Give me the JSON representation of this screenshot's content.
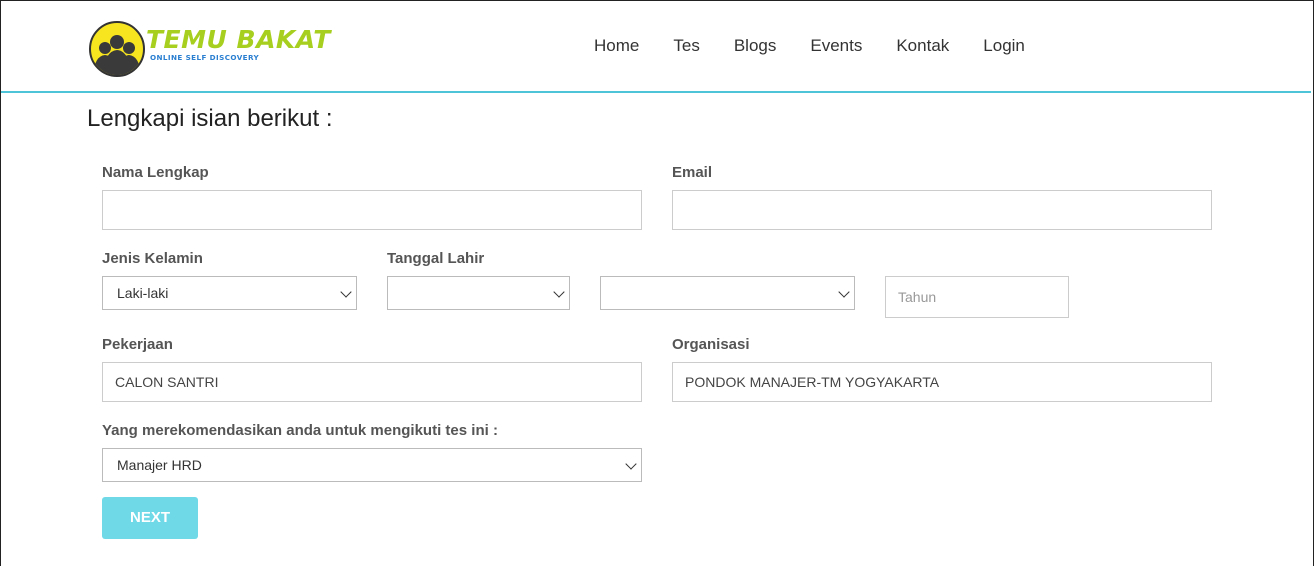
{
  "header": {
    "logo_text": "TEMU BAKAT",
    "logo_subtext": "ONLINE SELF DISCOVERY",
    "nav": [
      "Home",
      "Tes",
      "Blogs",
      "Events",
      "Kontak",
      "Login"
    ]
  },
  "form": {
    "title": "Lengkapi isian berikut :",
    "nama": {
      "label": "Nama Lengkap",
      "value": ""
    },
    "email": {
      "label": "Email",
      "value": ""
    },
    "jenis_kelamin": {
      "label": "Jenis Kelamin",
      "value": "Laki-laki"
    },
    "tanggal_lahir": {
      "label": "Tanggal Lahir",
      "day": "",
      "month": "",
      "year_placeholder": "Tahun"
    },
    "pekerjaan": {
      "label": "Pekerjaan",
      "value": "CALON SANTRI"
    },
    "organisasi": {
      "label": "Organisasi",
      "value": "PONDOK MANAJER-TM YOGYAKARTA"
    },
    "rekomendasi": {
      "label": "Yang merekomendasikan anda untuk mengikuti tes ini :",
      "value": "Manajer HRD"
    },
    "next_label": "NEXT"
  },
  "colors": {
    "accent": "#4ec4d8",
    "button": "#6fd9e8",
    "logo_green": "#a6cf1f",
    "logo_blue": "#2a7fd1",
    "logo_yellow": "#f7e51f"
  }
}
